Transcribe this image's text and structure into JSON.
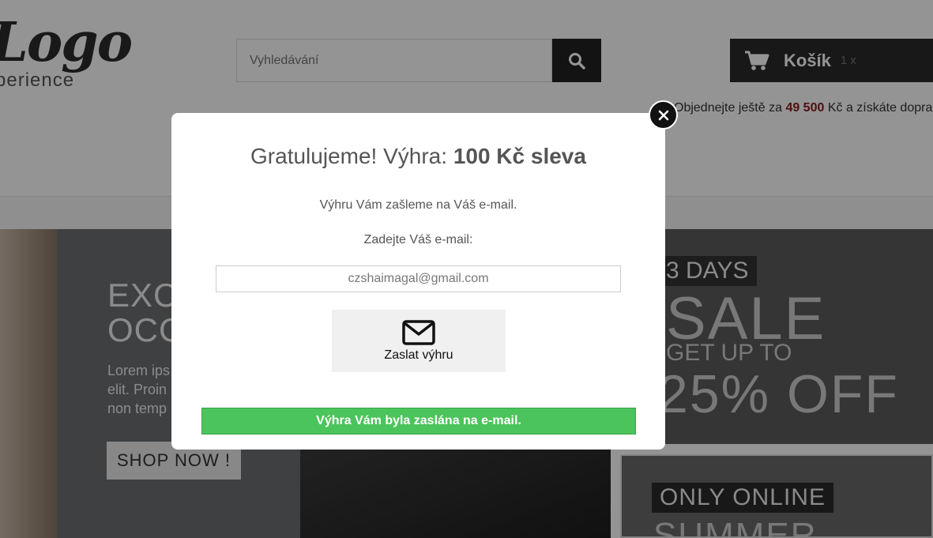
{
  "header": {
    "logo_text": "Logo",
    "logo_subtext": "perience",
    "search_placeholder": "Vyhledávání",
    "cart_label": "Košík",
    "cart_count": "1 x",
    "promo_prefix": "Objednejte ještě za",
    "promo_amount": "49 500",
    "promo_suffix": "Kč a získáte dopra"
  },
  "hero": {
    "title_line1": "EXC",
    "title_line2": "OCC",
    "text_line1": "Lorem ips",
    "text_line2": "elit. Proin",
    "text_line3": "non temp",
    "button_label": "SHOP NOW !"
  },
  "banners": {
    "days": "3 DAYS",
    "sale": "SALE",
    "get_up_to": "GET UP TO",
    "off": "25% OFF",
    "only_online": "ONLY ONLINE",
    "summer": "SUMMER"
  },
  "modal": {
    "title_regular": "Gratulujeme! Výhra: ",
    "title_bold": "100 Kč sleva",
    "info_text": "Výhru Vám zašleme na Váš e-mail.",
    "email_label": "Zadejte Váš e-mail:",
    "email_value": "czshaimagal@gmail.com",
    "send_button_label": "Zaslat výhru",
    "success_message": "Výhra Vám byla zaslána na e-mail."
  },
  "colors": {
    "success_green": "#4bc45b",
    "promo_accent": "#8b1a1a",
    "dark_button": "#222222"
  }
}
